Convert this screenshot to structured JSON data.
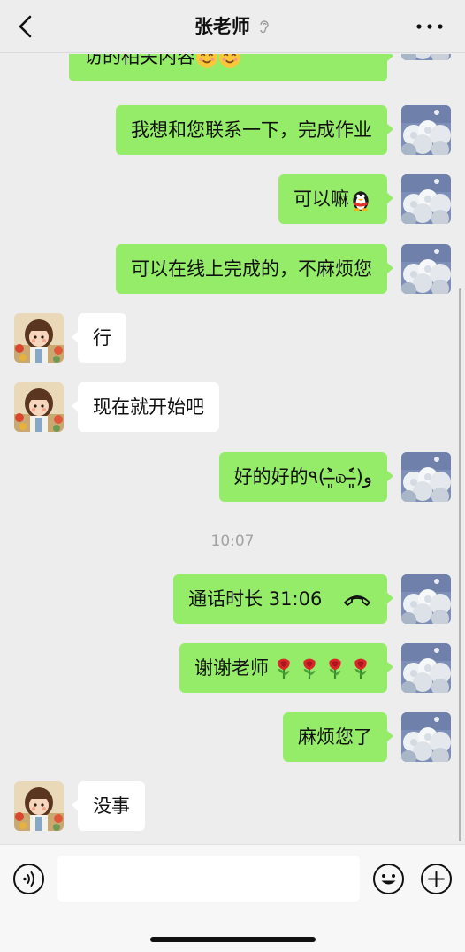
{
  "header": {
    "title": "张老师",
    "back_icon": "chevron-left-icon",
    "muted_icon": "ear-icon",
    "more_icon": "more-dots-icon"
  },
  "messages": [
    {
      "sender": "me",
      "text": "访的相关内容",
      "emoji": [
        "heart-eyes-emoji",
        "heart-eyes-emoji"
      ]
    },
    {
      "sender": "me",
      "text": "我想和您联系一下，完成作业"
    },
    {
      "sender": "me",
      "text": "可以嘛",
      "emoji": [
        "qq-penguin-emoji"
      ]
    },
    {
      "sender": "me",
      "text": "可以在线上完成的，不麻烦您"
    },
    {
      "sender": "them",
      "text": "行"
    },
    {
      "sender": "them",
      "text": "现在就开始吧"
    },
    {
      "sender": "me",
      "text": "好的好的٩(˃̶͈̀௰˂̶͈́)و"
    },
    {
      "sender": "me",
      "text": "通话时长 31:06",
      "icon": "phone-hangup-icon"
    },
    {
      "sender": "me",
      "text": "谢谢老师",
      "emoji": [
        "rose-emoji",
        "rose-emoji",
        "rose-emoji",
        "rose-emoji"
      ]
    },
    {
      "sender": "me",
      "text": "麻烦您了"
    },
    {
      "sender": "them",
      "text": "没事"
    }
  ],
  "timestamp": "10:07",
  "input": {
    "value": "",
    "voice_icon": "voice-icon",
    "emoji_icon": "emoji-face-icon",
    "plus_icon": "plus-icon"
  },
  "colors": {
    "background": "#ededed",
    "my_bubble": "#95ec69",
    "their_bubble": "#ffffff",
    "timestamp": "#a3a3a3"
  }
}
